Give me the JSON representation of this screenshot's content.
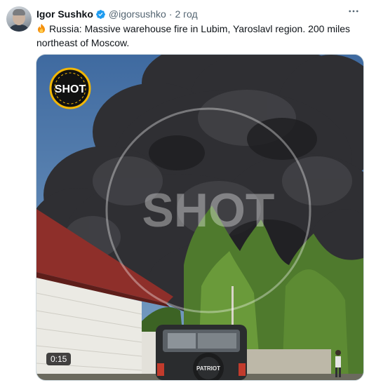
{
  "author": {
    "name": "Igor Sushko",
    "handle": "@igorsushko",
    "separator": "·",
    "time": "2 год",
    "verified_icon": "verified-badge-icon"
  },
  "menu_icon": "more-options-icon",
  "tweet": {
    "emoji_icon": "fire-emoji-icon",
    "text": "Russia: Massive warehouse fire in Lubim, Yaroslavl region. 200 miles northeast of Moscow."
  },
  "media": {
    "type": "video",
    "duration": "0:15",
    "watermark_logo": "SHOT",
    "watermark_center": "SHOT",
    "vehicle_badge": "PATRIOT",
    "license_plate": "",
    "colors": {
      "sky": "#5b7fa8",
      "smoke": "#2d2d30",
      "trees": "#4f7a2d",
      "roof": "#8e2f2a",
      "wall": "#e9e8e2"
    }
  },
  "colors": {
    "verified": "#1d9bf0",
    "text_primary": "#0f1419",
    "text_secondary": "#536471"
  }
}
